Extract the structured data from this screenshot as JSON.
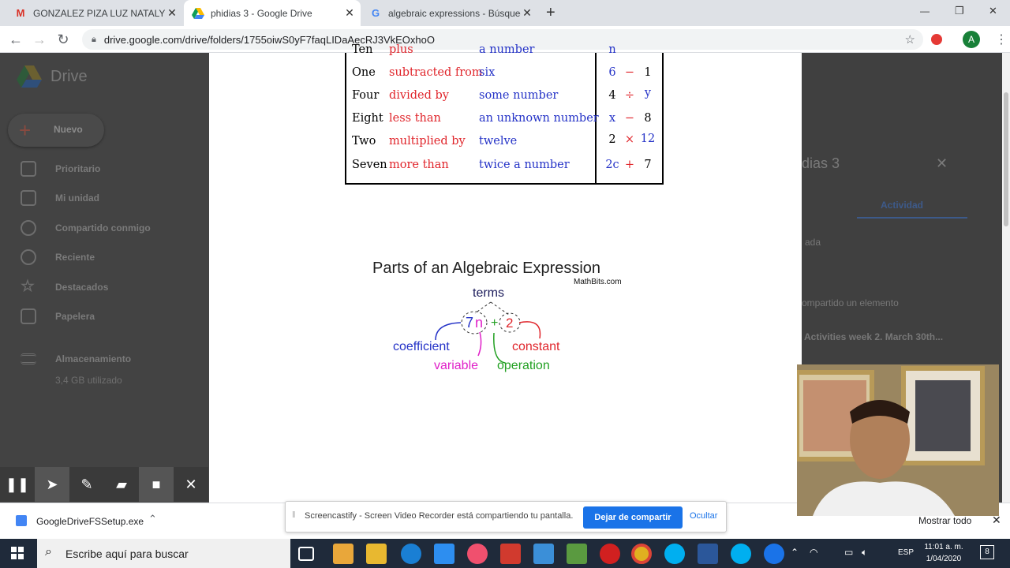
{
  "browser": {
    "tabs": [
      {
        "title": "GONZALEZ PIZA LUZ NATALY DC",
        "icon": "gmail-icon",
        "active": false
      },
      {
        "title": "phidias 3 - Google Drive",
        "icon": "drive-icon",
        "active": true
      },
      {
        "title": "algebraic expressions - Búsqueda",
        "icon": "google-icon",
        "active": false
      }
    ],
    "new_tab": "+",
    "url": "drive.google.com/drive/folders/1755oiwS0yF7faqLIDaAecRJ3VkEOxhoO",
    "window_controls": [
      "—",
      "❐",
      "✕"
    ],
    "profile_initial": "A"
  },
  "drive": {
    "app_name": "Drive",
    "new_button": "Nuevo",
    "sidebar": [
      {
        "label": "Prioritario",
        "icon": "check-square-icon"
      },
      {
        "label": "Mi unidad",
        "icon": "my-drive-icon"
      },
      {
        "label": "Compartido conmigo",
        "icon": "people-icon"
      },
      {
        "label": "Reciente",
        "icon": "clock-icon"
      },
      {
        "label": "Destacados",
        "icon": "star-icon"
      },
      {
        "label": "Papelera",
        "icon": "trash-icon"
      }
    ],
    "storage_label": "Almacenamiento",
    "storage_used": "3,4 GB utilizado",
    "details_title": "dias 3",
    "activity_tab": "Actividad",
    "activity_text_1": "ada",
    "activity_text_2": "ompartido un elemento",
    "activity_text_3": "Activities week 2. March 30th..."
  },
  "document": {
    "table_rows": [
      {
        "word": "Ten",
        "operation": "plus",
        "operand": "a number",
        "expr": [
          "n",
          "",
          ""
        ]
      },
      {
        "word": "One",
        "operation": "subtracted from",
        "operand": "six",
        "expr": [
          "6",
          "−",
          "1"
        ]
      },
      {
        "word": "Four",
        "operation": "divided by",
        "operand": "some number",
        "expr": [
          "4",
          "÷",
          "y"
        ]
      },
      {
        "word": "Eight",
        "operation": "less than",
        "operand": "an unknown number",
        "expr": [
          "x",
          "−",
          "8"
        ]
      },
      {
        "word": "Two",
        "operation": "multiplied by",
        "operand": "twelve",
        "expr": [
          "2",
          "×",
          "12"
        ]
      },
      {
        "word": "Seven",
        "operation": "more than",
        "operand": "twice a number",
        "expr": [
          "2c",
          "+",
          "7"
        ]
      }
    ],
    "diagram": {
      "title": "Parts of an Algebraic Expression",
      "source": "MathBits.com",
      "terms": "terms",
      "coef": "7",
      "var": "n",
      "plus": "+",
      "const": "2",
      "coefficient": "coefficient",
      "variable": "variable",
      "operation": "operation",
      "constant": "constant"
    }
  },
  "download_bar": {
    "file": "GoogleDriveFSSetup.exe",
    "show_all": "Mostrar todo"
  },
  "share_banner": {
    "message": "Screencastify - Screen Video Recorder está compartiendo tu pantalla.",
    "stop": "Dejar de compartir",
    "hide": "Ocultar"
  },
  "taskbar": {
    "search_placeholder": "Escribe aquí para buscar",
    "language": "ESP",
    "time": "11:01 a. m.",
    "date": "1/04/2020",
    "notifications": "8"
  },
  "colors": {
    "red": "#e0252b",
    "blue": "#2432c7",
    "magenta": "#e020c8",
    "green": "#22a022",
    "accent": "#1a73e8"
  }
}
